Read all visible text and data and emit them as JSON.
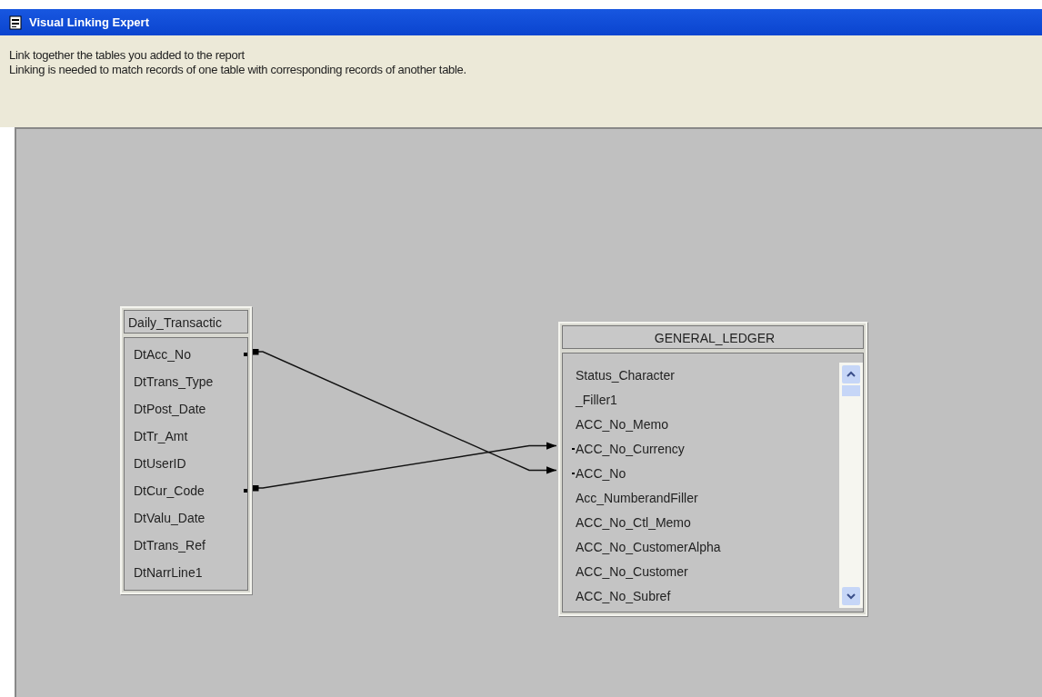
{
  "window": {
    "title": "Visual Linking Expert"
  },
  "instructions": [
    "Link together the tables you added to the report",
    "Linking is needed to match records of one table with corresponding records of another table."
  ],
  "tables": [
    {
      "title": "Daily_Transactic",
      "fields": [
        {
          "name": "DtAcc_No",
          "linked": true
        },
        {
          "name": "DtTrans_Type",
          "linked": false
        },
        {
          "name": "DtPost_Date",
          "linked": false
        },
        {
          "name": "DtTr_Amt",
          "linked": false
        },
        {
          "name": "DtUserID",
          "linked": false
        },
        {
          "name": "DtCur_Code",
          "linked": true
        },
        {
          "name": "DtValu_Date",
          "linked": false
        },
        {
          "name": "DtTrans_Ref",
          "linked": false
        },
        {
          "name": "DtNarrLine1",
          "linked": false
        }
      ]
    },
    {
      "title": "GENERAL_LEDGER",
      "fields": [
        {
          "name": "Status_Character",
          "linked": false
        },
        {
          "name": "_Filler1",
          "linked": false
        },
        {
          "name": "ACC_No_Memo",
          "linked": false
        },
        {
          "name": "ACC_No_Currency",
          "linked": true
        },
        {
          "name": "ACC_No",
          "linked": true
        },
        {
          "name": "Acc_NumberandFiller",
          "linked": false
        },
        {
          "name": "ACC_No_Ctl_Memo",
          "linked": false
        },
        {
          "name": "ACC_No_CustomerAlpha",
          "linked": false
        },
        {
          "name": "ACC_No_Customer",
          "linked": false
        },
        {
          "name": "ACC_No_Subref",
          "linked": false
        }
      ]
    }
  ],
  "links": {
    "crossed": true
  }
}
